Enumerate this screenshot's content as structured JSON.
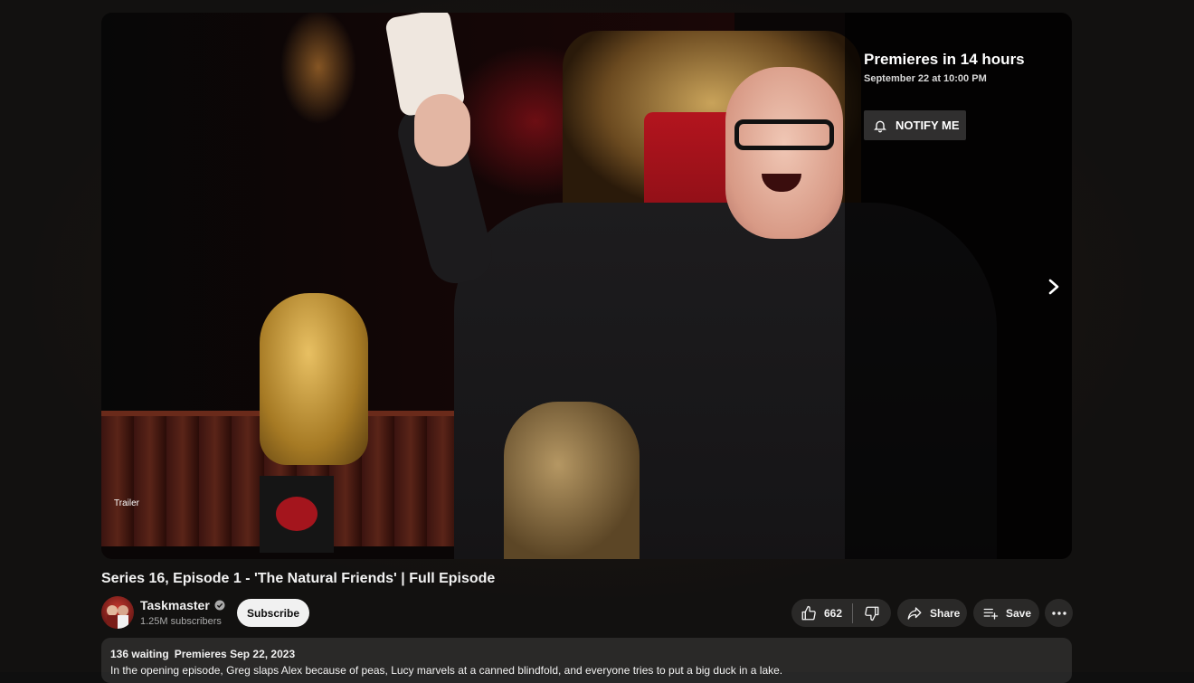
{
  "player": {
    "badge_label": "Trailer",
    "premiere_title": "Premieres in 14 hours",
    "premiere_date": "September 22 at 10:00 PM",
    "notify_label": "NOTIFY ME"
  },
  "video": {
    "title": "Series 16, Episode 1 - 'The Natural Friends' | Full Episode"
  },
  "channel": {
    "name": "Taskmaster",
    "subscribers": "1.25M subscribers",
    "subscribe_label": "Subscribe"
  },
  "actions": {
    "like_count": "662",
    "share_label": "Share",
    "save_label": "Save"
  },
  "description": {
    "waiting": "136 waiting",
    "premiere_date": "Premieres Sep 22, 2023",
    "text": "In the opening episode, Greg slaps Alex because of peas, Lucy marvels at a canned blindfold, and everyone tries to put a big duck in a lake."
  },
  "icons": {
    "notify": "bell-icon",
    "next": "chevron-right-icon",
    "verified": "verified-check-icon",
    "like": "thumbs-up-icon",
    "dislike": "thumbs-down-icon",
    "share": "share-arrow-icon",
    "save": "playlist-add-icon",
    "more": "more-horizontal-icon"
  },
  "colors": {
    "background": "#0f0f0f",
    "text": "#f1f1f1",
    "secondary_text": "#aaaaaa",
    "subscribe_bg": "#f1f1f1"
  }
}
